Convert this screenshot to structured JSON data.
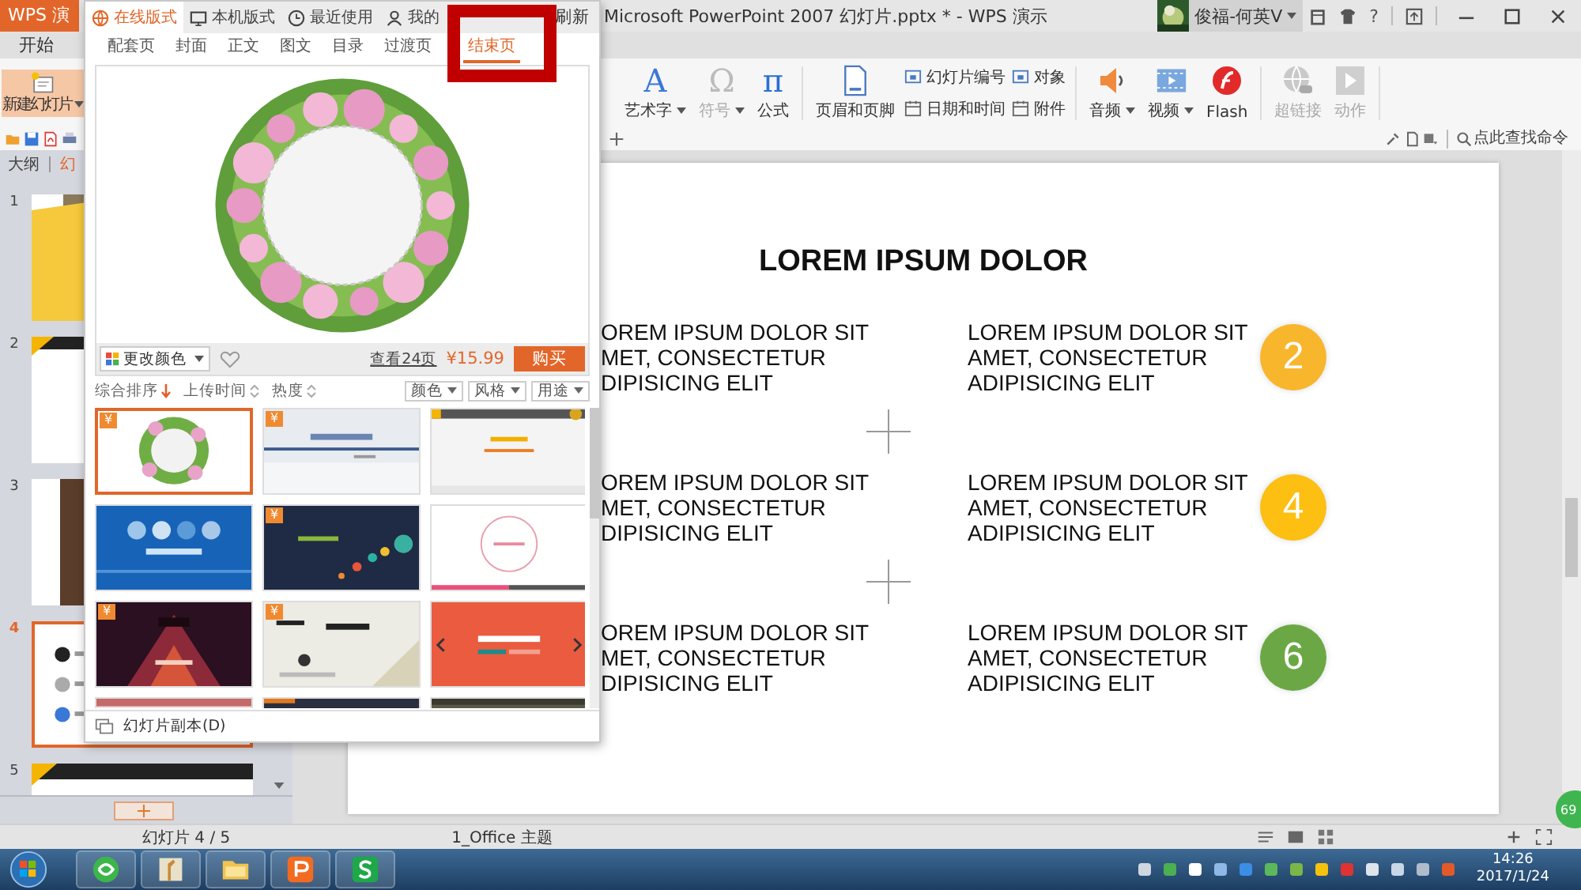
{
  "app": {
    "name": "WPS 演"
  },
  "window": {
    "title": "Microsoft PowerPoint 2007 幻灯片.pptx * - WPS 演示",
    "user": "俊福-何英V",
    "help": "?"
  },
  "menu_tabs": [
    {
      "label": "开始",
      "selected": false
    }
  ],
  "ribbon": {
    "new_slide": {
      "label": "新建幻灯片",
      "dropdown": true
    },
    "items": [
      {
        "kind": "large",
        "label": "艺术字",
        "glyph": "A",
        "dropdown": true,
        "disabled": false
      },
      {
        "kind": "large",
        "label": "符号",
        "glyph": "Ω",
        "dropdown": true,
        "disabled": true
      },
      {
        "kind": "large",
        "label": "公式",
        "glyph": "π",
        "dropdown": false,
        "disabled": false
      },
      {
        "kind": "large",
        "label": "页眉和页脚",
        "dropdown": false,
        "disabled": false
      },
      {
        "kind": "pair",
        "labels": [
          "幻灯片编号",
          "日期和时间"
        ],
        "dropdown": false,
        "disabled": false
      },
      {
        "kind": "pair",
        "labels": [
          "对象",
          "附件"
        ],
        "dropdown": false,
        "disabled": false
      },
      {
        "kind": "large",
        "label": "音频",
        "dropdown": true,
        "disabled": false
      },
      {
        "kind": "large",
        "label": "视频",
        "dropdown": true,
        "disabled": false
      },
      {
        "kind": "large",
        "label": "Flash",
        "dropdown": false,
        "disabled": false
      },
      {
        "kind": "large",
        "label": "超链接",
        "dropdown": false,
        "disabled": true
      },
      {
        "kind": "large",
        "label": "动作",
        "dropdown": false,
        "disabled": true
      }
    ]
  },
  "command_search": {
    "placeholder": "点此查找命令"
  },
  "slides_panel": {
    "tabs": [
      {
        "label": "大纲",
        "selected": false
      },
      {
        "label": "幻",
        "selected": true
      }
    ],
    "slides": [
      {
        "number": "1",
        "selected": false
      },
      {
        "number": "2",
        "selected": false
      },
      {
        "number": "3",
        "selected": false
      },
      {
        "number": "4",
        "selected": true
      },
      {
        "number": "5",
        "selected": false
      }
    ]
  },
  "slide": {
    "title": "LOREM IPSUM DOLOR",
    "rows": [
      {
        "left": [
          "OREM IPSUM DOLOR SIT",
          "MET, CONSECTETUR",
          "DIPISICING ELIT"
        ],
        "right": [
          "LOREM IPSUM DOLOR SIT",
          "AMET, CONSECTETUR",
          "ADIPISICING ELIT"
        ],
        "number": "2",
        "color": "#f8b62d"
      },
      {
        "left": [
          "OREM IPSUM DOLOR SIT",
          "MET, CONSECTETUR",
          "DIPISICING ELIT"
        ],
        "right": [
          "LOREM IPSUM DOLOR SIT",
          "AMET, CONSECTETUR",
          "ADIPISICING ELIT"
        ],
        "number": "4",
        "color": "#fcbf12"
      },
      {
        "left": [
          "OREM IPSUM DOLOR SIT",
          "MET, CONSECTETUR",
          "DIPISICING ELIT"
        ],
        "right": [
          "LOREM IPSUM DOLOR SIT",
          "AMET, CONSECTETUR",
          "ADIPISICING ELIT"
        ],
        "number": "6",
        "color": "#6ba845"
      }
    ]
  },
  "layout_panel": {
    "tabs": [
      {
        "label": "在线版式",
        "selected": true
      },
      {
        "label": "本机版式",
        "selected": false
      },
      {
        "label": "最近使用",
        "selected": false
      },
      {
        "label": "我的",
        "selected": false
      }
    ],
    "refresh": "刷新",
    "categories": [
      {
        "label": "配套页",
        "selected": false
      },
      {
        "label": "封面",
        "selected": false
      },
      {
        "label": "正文",
        "selected": false
      },
      {
        "label": "图文",
        "selected": false
      },
      {
        "label": "目录",
        "selected": false
      },
      {
        "label": "过渡页",
        "selected": false
      },
      {
        "label": "结束页",
        "selected": true
      }
    ],
    "preview": {
      "kind": "picture",
      "change_color": "更改颜色",
      "favorite": false,
      "pages": "查看24页",
      "price": "¥15.99",
      "buy": "购买"
    },
    "sort": [
      {
        "label": "综合排序",
        "selected": true
      },
      {
        "label": "上传时间",
        "selected": false
      },
      {
        "label": "热度",
        "selected": false
      }
    ],
    "filters": [
      "颜色",
      "风格",
      "用途"
    ],
    "templates": [
      {
        "badge": "¥",
        "selected": true
      },
      {
        "badge": "¥",
        "selected": false
      },
      {
        "selected": false
      },
      {
        "selected": false
      },
      {
        "badge": "¥",
        "selected": false
      },
      {
        "selected": false
      },
      {
        "badge": "¥",
        "selected": false
      },
      {
        "badge": "¥",
        "selected": false
      },
      {
        "selected": false
      },
      {
        "selected": false
      },
      {
        "selected": false
      },
      {
        "selected": false
      }
    ],
    "footer": "幻灯片副本(D)"
  },
  "status_bar": {
    "slide_info": "幻灯片 4 / 5",
    "theme": "1_Office 主题"
  },
  "floating_badge": "69",
  "taskbar": {
    "time": "14:26",
    "date": "2017/1/24"
  }
}
